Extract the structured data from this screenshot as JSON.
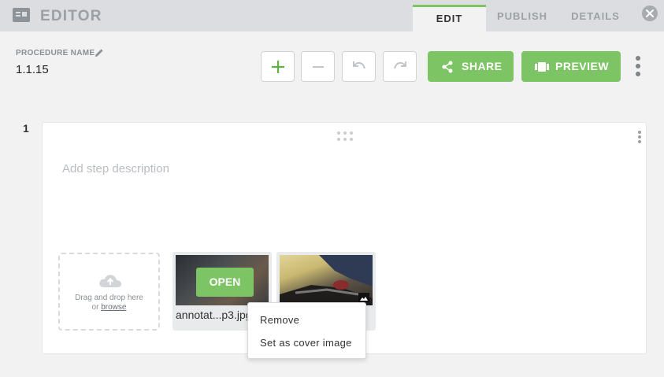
{
  "header": {
    "title": "EDITOR",
    "tabs": [
      {
        "label": "EDIT",
        "active": true
      },
      {
        "label": "PUBLISH",
        "active": false
      },
      {
        "label": "DETAILS",
        "active": false
      }
    ]
  },
  "procedure": {
    "label": "PROCEDURE NAME",
    "value": "1.1.15"
  },
  "toolbar": {
    "share_label": "SHARE",
    "preview_label": "PREVIEW"
  },
  "step": {
    "number": "1",
    "description_placeholder": "Add step description",
    "dropzone": {
      "line1": "Drag and drop here",
      "or_text": "or",
      "browse_text": "browse"
    },
    "attachments": [
      {
        "open_label": "OPEN",
        "name": "annotat...p3.jpg"
      }
    ]
  },
  "context_menu": {
    "items": [
      "Remove",
      "Set as cover image"
    ]
  },
  "colors": {
    "accent": "#7dc464",
    "header_bg": "#dcdde0",
    "page_bg": "#f2f2f2"
  }
}
